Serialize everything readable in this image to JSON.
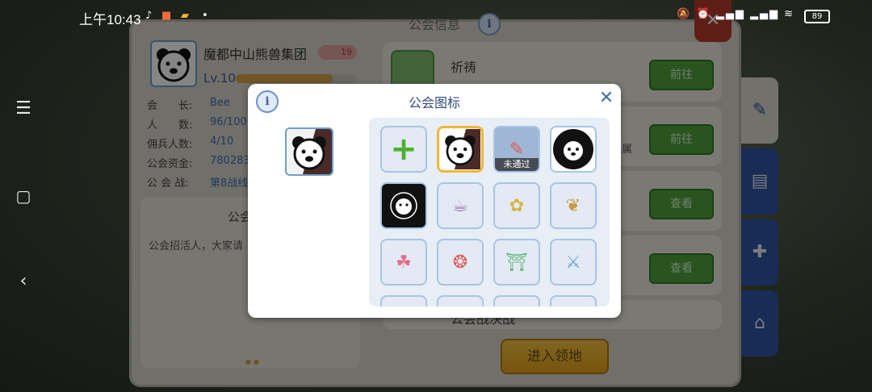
{
  "status_bar": {
    "time": "上午10:43",
    "battery": "89"
  },
  "background": {
    "panel_title": "公会信息",
    "guild_name": "魔都中山熊兽集团",
    "guild_badge": "19",
    "guild_level": "Lv.10",
    "fields": [
      {
        "label": "会　　长:",
        "value": "Bee"
      },
      {
        "label": "人　　数:",
        "value": "96/100"
      },
      {
        "label": "佣兵人数:",
        "value": "4/10"
      },
      {
        "label": "公会资金:",
        "value": "78028322"
      },
      {
        "label": "公 会 战:",
        "value": "第8战线"
      }
    ],
    "notice_title": "公会",
    "notice_text": "公会招活人，大家请",
    "activities": [
      {
        "name": "祈祷",
        "button": "前往"
      },
      {
        "name": "",
        "button": "前往"
      },
      {
        "name": "",
        "button": "查看"
      },
      {
        "name": "",
        "button": "查看"
      },
      {
        "name": "公会战决战",
        "button": ""
      }
    ],
    "activity_partial_text": "属",
    "enter_button": "进入领地"
  },
  "modal": {
    "title": "公会图标",
    "icons": [
      {
        "name": "add-icon-button",
        "glyph": "+",
        "tag": ""
      },
      {
        "name": "bear-logo",
        "glyph": "",
        "tag": "",
        "selected": true
      },
      {
        "name": "custom-icon-pending",
        "glyph": "✎",
        "tag": "未通过"
      },
      {
        "name": "zhongshan-round-logo",
        "glyph": "",
        "tag": ""
      },
      {
        "name": "bears-dark-logo",
        "glyph": "",
        "tag": ""
      },
      {
        "name": "mug-icon",
        "glyph": "☕",
        "tag": ""
      },
      {
        "name": "flower-icon",
        "glyph": "✿",
        "tag": ""
      },
      {
        "name": "paw-icon",
        "glyph": "❦",
        "tag": ""
      },
      {
        "name": "clover-icon",
        "glyph": "☘",
        "tag": ""
      },
      {
        "name": "wings-icon",
        "glyph": "❂",
        "tag": ""
      },
      {
        "name": "gate-icon",
        "glyph": "⛩",
        "tag": ""
      },
      {
        "name": "crossed-swords-icon",
        "glyph": "⚔",
        "tag": ""
      },
      {
        "name": "partial-icon-1",
        "glyph": "",
        "tag": ""
      },
      {
        "name": "partial-icon-2",
        "glyph": "",
        "tag": ""
      },
      {
        "name": "partial-icon-3",
        "glyph": "",
        "tag": ""
      },
      {
        "name": "partial-icon-4",
        "glyph": "",
        "tag": ""
      }
    ]
  }
}
